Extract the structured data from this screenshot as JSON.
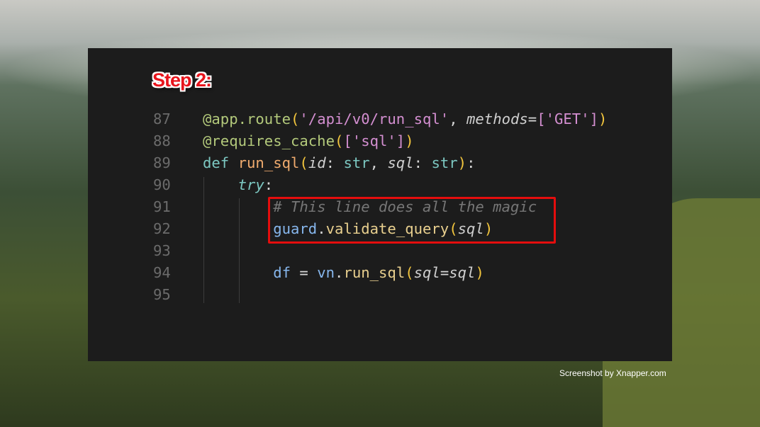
{
  "title": "Step 2:",
  "credit": "Screenshot by Xnapper.com",
  "code": {
    "lines": [
      {
        "number": "87",
        "indent": 0,
        "tokens": [
          [
            "@app.route",
            "dec"
          ],
          [
            "(",
            "br"
          ],
          [
            "'/api/v0/run_sql'",
            "str"
          ],
          [
            ", ",
            "pl"
          ],
          [
            "methods",
            "it"
          ],
          [
            "=",
            "pl"
          ],
          [
            "[",
            "str"
          ],
          [
            "'GET'",
            "str"
          ],
          [
            "]",
            "str"
          ],
          [
            ")",
            "br"
          ]
        ]
      },
      {
        "number": "88",
        "indent": 0,
        "tokens": [
          [
            "@requires_cache",
            "dec"
          ],
          [
            "(",
            "br"
          ],
          [
            "[",
            "str"
          ],
          [
            "'sql'",
            "str"
          ],
          [
            "]",
            "str"
          ],
          [
            ")",
            "br"
          ]
        ]
      },
      {
        "number": "89",
        "indent": 0,
        "tokens": [
          [
            "def ",
            "kw"
          ],
          [
            "run_sql",
            "fn"
          ],
          [
            "(",
            "br"
          ],
          [
            "id",
            "it"
          ],
          [
            ": ",
            "pl"
          ],
          [
            "str",
            "kw"
          ],
          [
            ", ",
            "pl"
          ],
          [
            "sql",
            "it"
          ],
          [
            ": ",
            "pl"
          ],
          [
            "str",
            "kw"
          ],
          [
            ")",
            "br"
          ],
          [
            ":",
            "pl"
          ]
        ]
      },
      {
        "number": "90",
        "indent": 4,
        "tokens": [
          [
            "try",
            "kw it"
          ],
          [
            ":",
            "pl"
          ]
        ]
      },
      {
        "number": "91",
        "indent": 8,
        "tokens": [
          [
            "# This line does all the magic",
            "cm"
          ]
        ]
      },
      {
        "number": "92",
        "indent": 8,
        "tokens": [
          [
            "guard",
            "var"
          ],
          [
            ".",
            "pl"
          ],
          [
            "validate_query",
            "meth"
          ],
          [
            "(",
            "br"
          ],
          [
            "sql",
            "it"
          ],
          [
            ")",
            "br"
          ]
        ]
      },
      {
        "number": "93",
        "indent": 0,
        "tokens": []
      },
      {
        "number": "94",
        "indent": 8,
        "tokens": [
          [
            "df",
            "var"
          ],
          [
            " = ",
            "pl"
          ],
          [
            "vn",
            "var"
          ],
          [
            ".",
            "pl"
          ],
          [
            "run_sql",
            "meth"
          ],
          [
            "(",
            "br"
          ],
          [
            "sql",
            "it"
          ],
          [
            "=",
            "pl"
          ],
          [
            "sql",
            "it"
          ],
          [
            ")",
            "br"
          ]
        ]
      },
      {
        "number": "95",
        "indent": 0,
        "tokens": []
      }
    ],
    "highlighted_lines": [
      "91",
      "92"
    ],
    "highlight_color": "#e40d0d"
  }
}
